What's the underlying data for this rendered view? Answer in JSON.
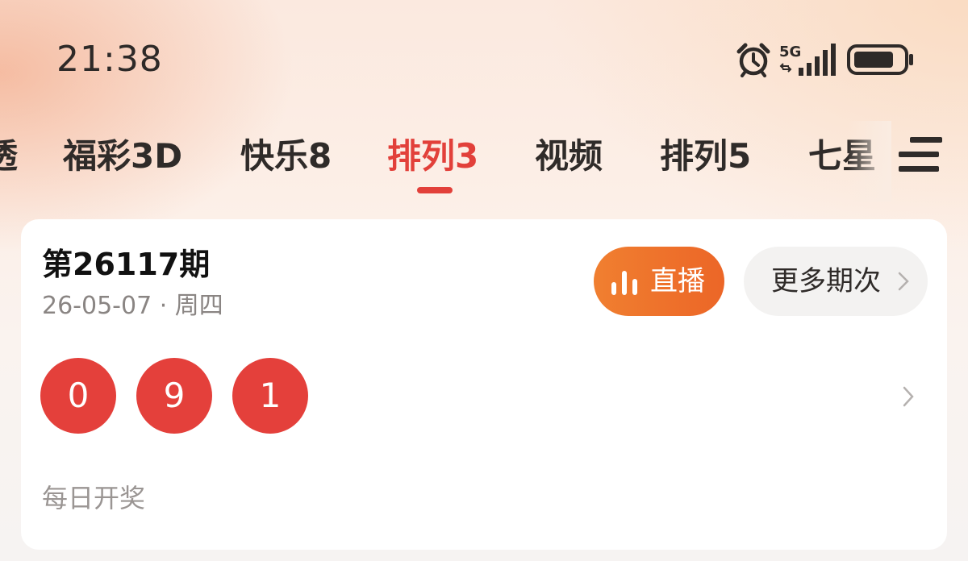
{
  "status_bar": {
    "time": "21:38",
    "network": "5G",
    "icons": [
      "alarm-icon",
      "signal-5g-icon",
      "battery-icon"
    ]
  },
  "tabs": [
    {
      "label": "透",
      "partial": true
    },
    {
      "label": "福彩3D"
    },
    {
      "label": "快乐8"
    },
    {
      "label": "排列3",
      "active": true
    },
    {
      "label": "视频"
    },
    {
      "label": "排列5"
    },
    {
      "label": "七星",
      "partial": true
    }
  ],
  "menu": {
    "icon": "menu-icon"
  },
  "draw": {
    "title": "第26117期",
    "date": "26-05-07 · 周四",
    "live_label": "直播",
    "live_icon": "bar-chart-icon",
    "more_label": "更多期次",
    "numbers": [
      "0",
      "9",
      "1"
    ],
    "schedule": "每日开奖"
  },
  "colors": {
    "accent": "#e2403a",
    "ball": "#e4403b",
    "live_button": "#ef7430",
    "text_primary": "#2f2b29",
    "text_secondary": "#8a8583"
  }
}
